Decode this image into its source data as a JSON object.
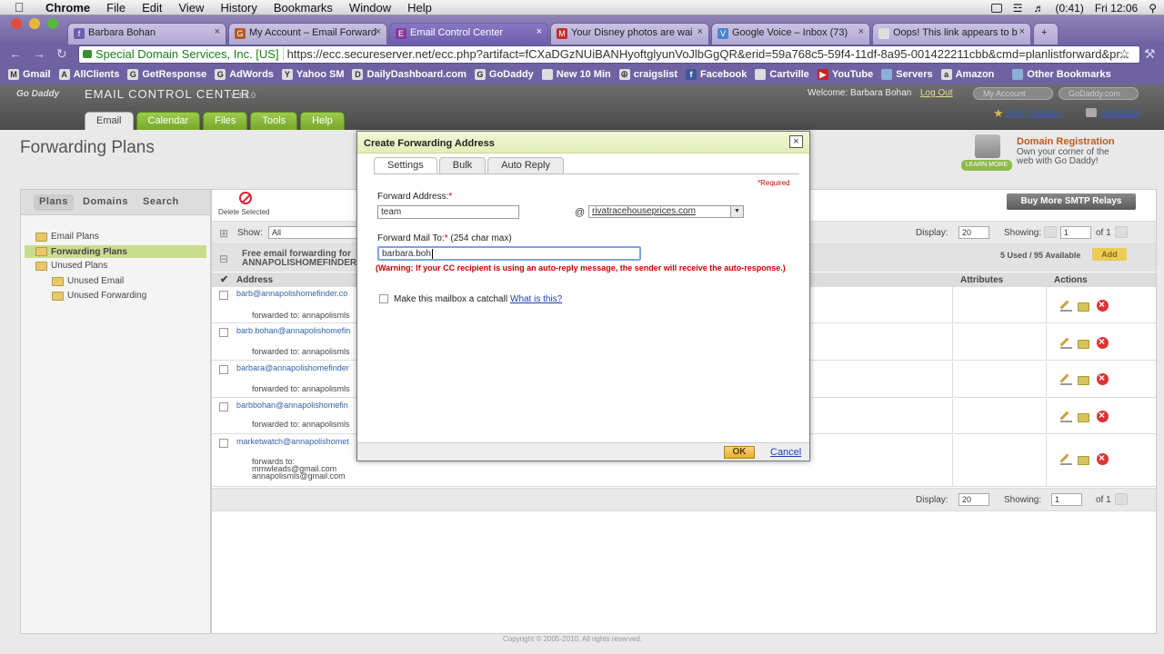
{
  "menubar": {
    "app": "Chrome",
    "items": [
      "File",
      "Edit",
      "View",
      "History",
      "Bookmarks",
      "Window",
      "Help"
    ],
    "battery": "(0:41)",
    "clock": "Fri 12:06"
  },
  "tabs": [
    {
      "label": "Barbara Bohan",
      "fav": "#6a5fae"
    },
    {
      "label": "My Account – Email Forward",
      "fav": "#b35b2a"
    },
    {
      "label": "Email Control Center",
      "fav": "#8a3a9a"
    },
    {
      "label": "Your Disney photos are wai",
      "fav": "#c42c2c"
    },
    {
      "label": "Google Voice – Inbox (73)",
      "fav": "#4a86d0"
    },
    {
      "label": "Oops! This link appears to b",
      "fav": "#ddd"
    }
  ],
  "omnibox": {
    "identity": "Special Domain Services, Inc. [US]",
    "url": "https://ecc.secureserver.net/ecc.php?artifact=fCXaDGzNUiBANHyoftglyunVoJlbGgQR&erid=59a768c5-59f4-11df-8a95-001422211cbb&cmd=planlistforward&pr..."
  },
  "bookmarks": [
    "Gmail",
    "AllClients",
    "GetResponse",
    "AdWords",
    "Yahoo SM",
    "DailyDashboard.com",
    "GoDaddy",
    "New 10 Min",
    "craigslist",
    "Facebook",
    "Cartville",
    "YouTube",
    "Servers",
    "Amazon",
    "Other Bookmarks"
  ],
  "header": {
    "logo": "Go Daddy",
    "title": "EMAIL CONTROL CENTER",
    "version": "v 3.3.0",
    "welcome": "Welcome: Barbara Bohan",
    "logout": "Log Out",
    "my_account": "My Account",
    "godaddy": "GoDaddy.com",
    "tabs": [
      "Email",
      "Calendar",
      "Files",
      "Tools",
      "Help"
    ],
    "new_features": "New Features",
    "feedback": "Feedback"
  },
  "page": {
    "title": "Forwarding Plans",
    "promo_title": "Domain Registration",
    "promo_text": "Own your corner of the web with Go Daddy!",
    "promo_btn": "LEARN MORE",
    "copyright": "Copyright © 2005-2010. All rights reserved."
  },
  "left": {
    "tabs": [
      "Plans",
      "Domains",
      "Search"
    ],
    "tree": [
      "Email Plans",
      "Forwarding Plans",
      "Unused Plans",
      "Unused Email",
      "Unused Forwarding"
    ]
  },
  "list": {
    "delete_selected": "Delete Selected",
    "buy_smtp": "Buy More SMTP Relays",
    "show_label": "Show:",
    "show_value": "All",
    "display_label": "Display:",
    "display_value": "20",
    "showing_label": "Showing:",
    "page_value": "1",
    "of_label": "of 1",
    "free_fwd": "Free email forwarding for ANNAPOLISHOMEFINDER.",
    "used": "5 Used / 95 Available",
    "add": "Add",
    "col_address": "Address",
    "col_attributes": "Attributes",
    "col_actions": "Actions",
    "rows": [
      {
        "addr": "barb@annapolishomefinder.co",
        "fwd": "forwarded to: annapolismls"
      },
      {
        "addr": "barb.bohan@annapolishomefin",
        "fwd": "forwarded to: annapolismls"
      },
      {
        "addr": "barbara@annapolishomefinder",
        "fwd": "forwarded to: annapolismls"
      },
      {
        "addr": "barbbohan@annapolishomefin",
        "fwd": "forwarded to: annapolismls"
      },
      {
        "addr": "marketwatch@annapolishomet",
        "fwd": "forwards to:",
        "fwd2": "mmwleads@gmail.com",
        "fwd3": "annapolismls@gmail.com"
      }
    ]
  },
  "modal": {
    "title": "Create Forwarding Address",
    "close": "×",
    "tabs": [
      "Settings",
      "Bulk",
      "Auto Reply"
    ],
    "required": "*Required",
    "fwd_addr_label": "Forward Address:",
    "fwd_addr_value": "team",
    "at": "@",
    "domain_value": "rivatracehouseprices.com",
    "mailto_label": "Forward Mail To:",
    "mailto_hint": " (254 char max)",
    "mailto_value": "barbara.boh",
    "warning": "(Warning: If your CC recipient is using an auto-reply message, the sender will receive the auto-response.)",
    "catchall": "Make this mailbox a catchall",
    "whatis": "What is this?",
    "ok": "OK",
    "cancel": "Cancel"
  }
}
